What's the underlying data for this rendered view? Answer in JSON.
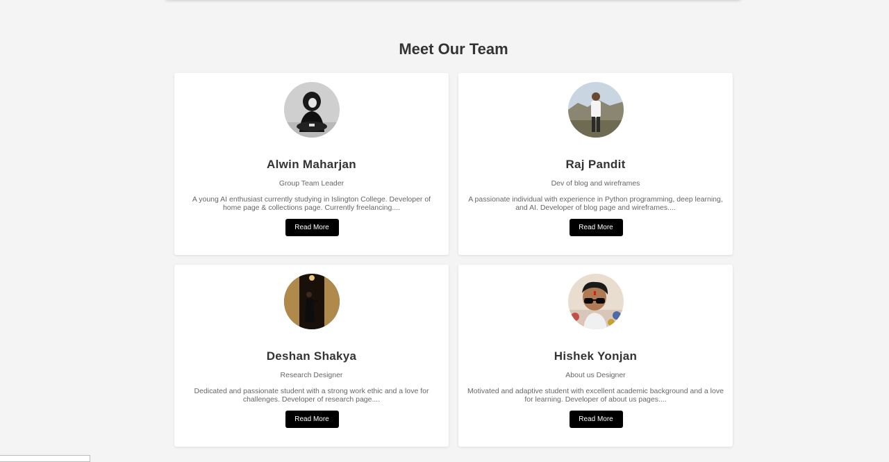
{
  "section": {
    "title": "Meet Our Team"
  },
  "team": [
    {
      "name": "Alwin Maharjan",
      "role": "Group Team Leader",
      "bio": "A young AI enthusiast currently studying in Islington College. Developer of home page & collections page. Currently freelancing....",
      "button": "Read More",
      "avatar_icon": "person-photo-icon"
    },
    {
      "name": "Raj Pandit",
      "role": "Dev of blog and wireframes",
      "bio": "A passionate individual with experience in Python programming, deep learning, and AI. Developer of blog page and wireframes....",
      "button": "Read More",
      "avatar_icon": "person-photo-icon"
    },
    {
      "name": "Deshan Shakya",
      "role": "Research Designer",
      "bio": "Dedicated and passionate student with a strong work ethic and a love for challenges. Developer of research page....",
      "button": "Read More",
      "avatar_icon": "person-photo-icon"
    },
    {
      "name": "Hishek Yonjan",
      "role": "About us Designer",
      "bio": "Motivated and adaptive student with excellent academic background and a love for learning. Developer of about us pages....",
      "button": "Read More",
      "avatar_icon": "person-photo-icon"
    }
  ],
  "colors": {
    "background": "#f4f4f4",
    "card": "#ffffff",
    "button": "#000000",
    "button_text": "#ffffff",
    "heading": "#333333",
    "muted": "#666666"
  }
}
